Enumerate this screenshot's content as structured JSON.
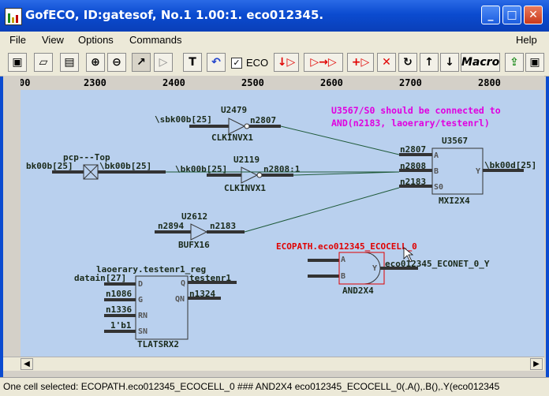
{
  "window": {
    "title": "GofECO, ID:gatesof, No.1 1.00:1. eco012345."
  },
  "menu": {
    "file": "File",
    "view": "View",
    "options": "Options",
    "commands": "Commands",
    "help": "Help"
  },
  "toolbar": {
    "eco_label": "ECO",
    "macro_label": "Macro"
  },
  "ruler": {
    "ticks": [
      "00",
      "2300",
      "2400",
      "2500",
      "2600",
      "2700",
      "2800"
    ]
  },
  "schematic": {
    "note_line1": "U3567/S0 should be connected to",
    "note_line2": "AND(n2183, laoerary/testenrl)",
    "u2479": {
      "name": "U2479",
      "cell": "CLKINVX1",
      "in": "\\sbk00b[25]",
      "out": "n2807"
    },
    "pcp": {
      "name": "pcp---Top",
      "in": "bk00b[25]",
      "out": "\\bk00b[25]"
    },
    "u2119": {
      "name": "U2119",
      "cell": "CLKINVX1",
      "in": "\\bk00b[25]",
      "out": "n2808:1"
    },
    "u2612": {
      "name": "U2612",
      "cell": "BUFX16",
      "in": "n2894",
      "out": "n2183"
    },
    "u3567": {
      "name": "U3567",
      "cell": "MXI2X4",
      "pin_a": "A",
      "pin_b": "B",
      "pin_s0": "S0",
      "pin_y": "Y",
      "net_a": "n2807",
      "net_b": "n2808",
      "net_s0": "n2183",
      "net_y": "\\bk00d[25]"
    },
    "eco": {
      "path": "ECOPATH.eco012345_ECOCELL_0",
      "cell": "AND2X4",
      "pin_a": "A",
      "pin_b": "B",
      "pin_y": "Y",
      "net_y": "eco012345_ECONET_0_Y"
    },
    "reg": {
      "name": "laoerary.testenr1_reg",
      "cell": "TLATSRX2",
      "pins": [
        "D",
        "G",
        "RN",
        "SN",
        "Q",
        "QN"
      ],
      "nets": [
        "datain[27]",
        "n1086",
        "n1336",
        "1'b1",
        "testenr1",
        "n1324"
      ]
    }
  },
  "status": {
    "text": "One cell selected: ECOPATH.eco012345_ECOCELL_0 ### AND2X4 eco012345_ECOCELL_0(.A(),.B(),.Y(eco012345"
  },
  "colors": {
    "canvas": "#b9d0ee",
    "wire": "#1f5a3a",
    "note": "#e000e0",
    "eco_path": "#e00000",
    "pin": "#555555"
  }
}
